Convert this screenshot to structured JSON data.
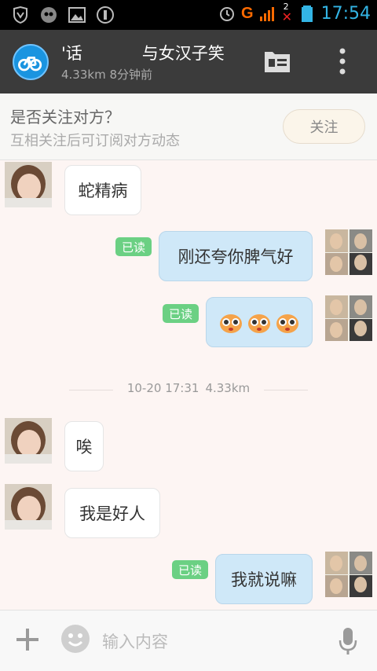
{
  "status_bar": {
    "time": "17:54",
    "network_label": "G",
    "sim_badge": "2",
    "icons": [
      "shield-icon",
      "chat-notification-icon",
      "image-icon",
      "sync-icon",
      "alarm-icon",
      "signal-icon",
      "battery-icon"
    ]
  },
  "header": {
    "title_part1": "'话",
    "title_part2": "与女汉子笑",
    "subtitle": "4.33km 8分钟前",
    "avatar_icon": "bicycle-icon"
  },
  "follow_bar": {
    "title": "是否关注对方？",
    "subtitle": "互相关注后可订阅对方动态",
    "button_label": "关注"
  },
  "chat": {
    "divider": {
      "time": "10-20 17:31",
      "distance": "4.33km"
    },
    "messages": [
      {
        "side": "in",
        "text": "蛇精病"
      },
      {
        "side": "out",
        "text": "刚还夸你脾气好",
        "read": "已读"
      },
      {
        "side": "out",
        "text": "",
        "emoji_count": 3,
        "read": "已读"
      },
      {
        "side": "in",
        "text": "唉"
      },
      {
        "side": "in",
        "text": "我是好人"
      },
      {
        "side": "out",
        "text": "我就说嘛",
        "read": "已读"
      }
    ]
  },
  "input_bar": {
    "placeholder": "输入内容",
    "icons": [
      "plus-icon",
      "emoji-icon",
      "microphone-icon"
    ]
  },
  "colors": {
    "accent": "#33b5e5",
    "header_bg": "#3b3b3b",
    "read_badge": "#6bd083",
    "out_bubble": "#cfe8f8",
    "chat_bg": "#fdf5f3"
  }
}
